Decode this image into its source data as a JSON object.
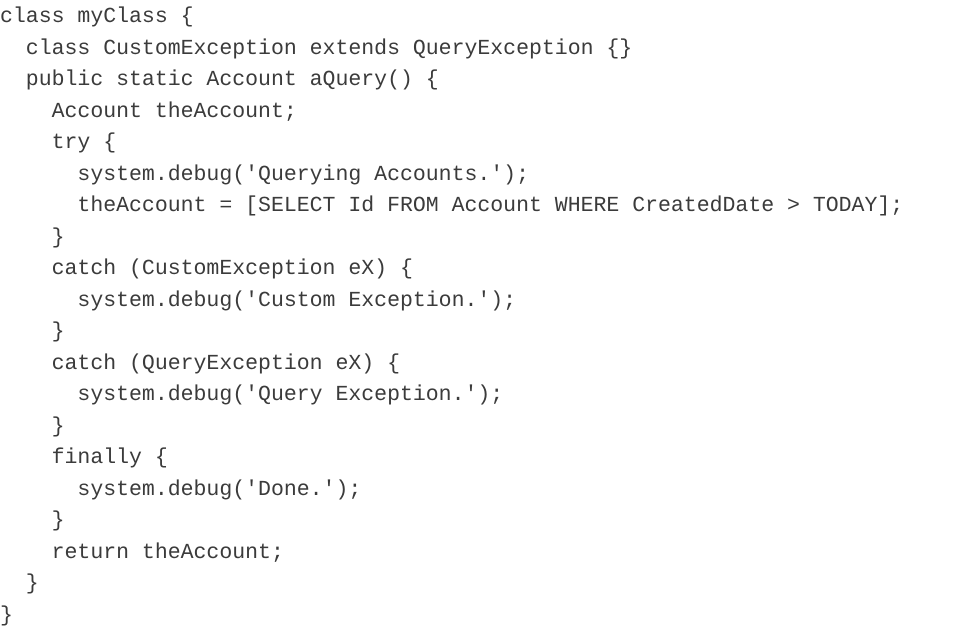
{
  "document": {
    "type": "code-listing",
    "language": "Apex",
    "background_color": "#ffffff",
    "text_color": "#3b3b3b",
    "class_name": "myClass",
    "method_name": "aQuery",
    "lines": [
      "class myClass {",
      "  class CustomException extends QueryException {}",
      "  public static Account aQuery() {",
      "    Account theAccount;",
      "    try {",
      "      system.debug('Querying Accounts.');",
      "      theAccount = [SELECT Id FROM Account WHERE CreatedDate > TODAY];",
      "    }",
      "    catch (CustomException eX) {",
      "      system.debug('Custom Exception.');",
      "    }",
      "    catch (QueryException eX) {",
      "      system.debug('Query Exception.');",
      "    }",
      "    finally {",
      "      system.debug('Done.');",
      "    }",
      "    return theAccount;",
      "  }",
      "}"
    ]
  }
}
